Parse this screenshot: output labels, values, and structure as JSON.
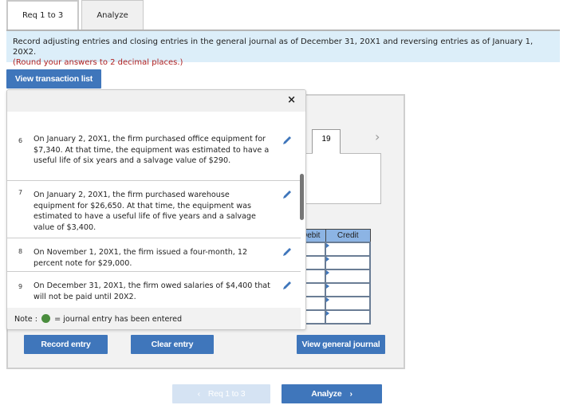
{
  "tabs": [
    {
      "label": "Req 1 to 3",
      "active": true
    },
    {
      "label": "Analyze",
      "active": false
    }
  ],
  "instructions": {
    "main": "Record adjusting entries and closing entries in the general journal as of December 31, 20X1 and reversing entries as of January 1, 20X2.",
    "note": "(Round your answers to 2 decimal places.)"
  },
  "view_transaction_list_label": "View transaction list",
  "popup": {
    "close_icon": "×",
    "transactions": [
      {
        "number": "6",
        "text": "On January 2, 20X1, the firm purchased office equipment for $7,340. At that time, the equipment was estimated to have a useful life of six years and a salvage value of $290."
      },
      {
        "number": "7",
        "text": "On January 2, 20X1, the firm purchased warehouse equipment for $26,650. At that time, the equipment was estimated to have a useful life of five years and a salvage value of $3,400."
      },
      {
        "number": "8",
        "text": "On November 1, 20X1, the firm issued a four-month, 12 percent note for $29,000."
      },
      {
        "number": "9",
        "text": "On December 31, 20X1, the firm owed salaries of $4,400 that will not be paid until 20X2."
      }
    ],
    "note_prefix": "Note :",
    "note_suffix": "= journal entry has been entered"
  },
  "journal": {
    "entry_number": "19",
    "next_arrow": "›",
    "columns": {
      "debit": "Debit",
      "credit": "Credit"
    },
    "rows": 6
  },
  "buttons": {
    "record_entry": "Record entry",
    "clear_entry": "Clear entry",
    "view_general_journal": "View general journal"
  },
  "nav": {
    "prev_label": "Req 1 to 3",
    "next_label": "Analyze"
  },
  "colors": {
    "accent": "#3f76bb",
    "entered_dot": "#4a8d3e",
    "instruction_bg": "#dceef9",
    "round_note": "#b02020"
  }
}
